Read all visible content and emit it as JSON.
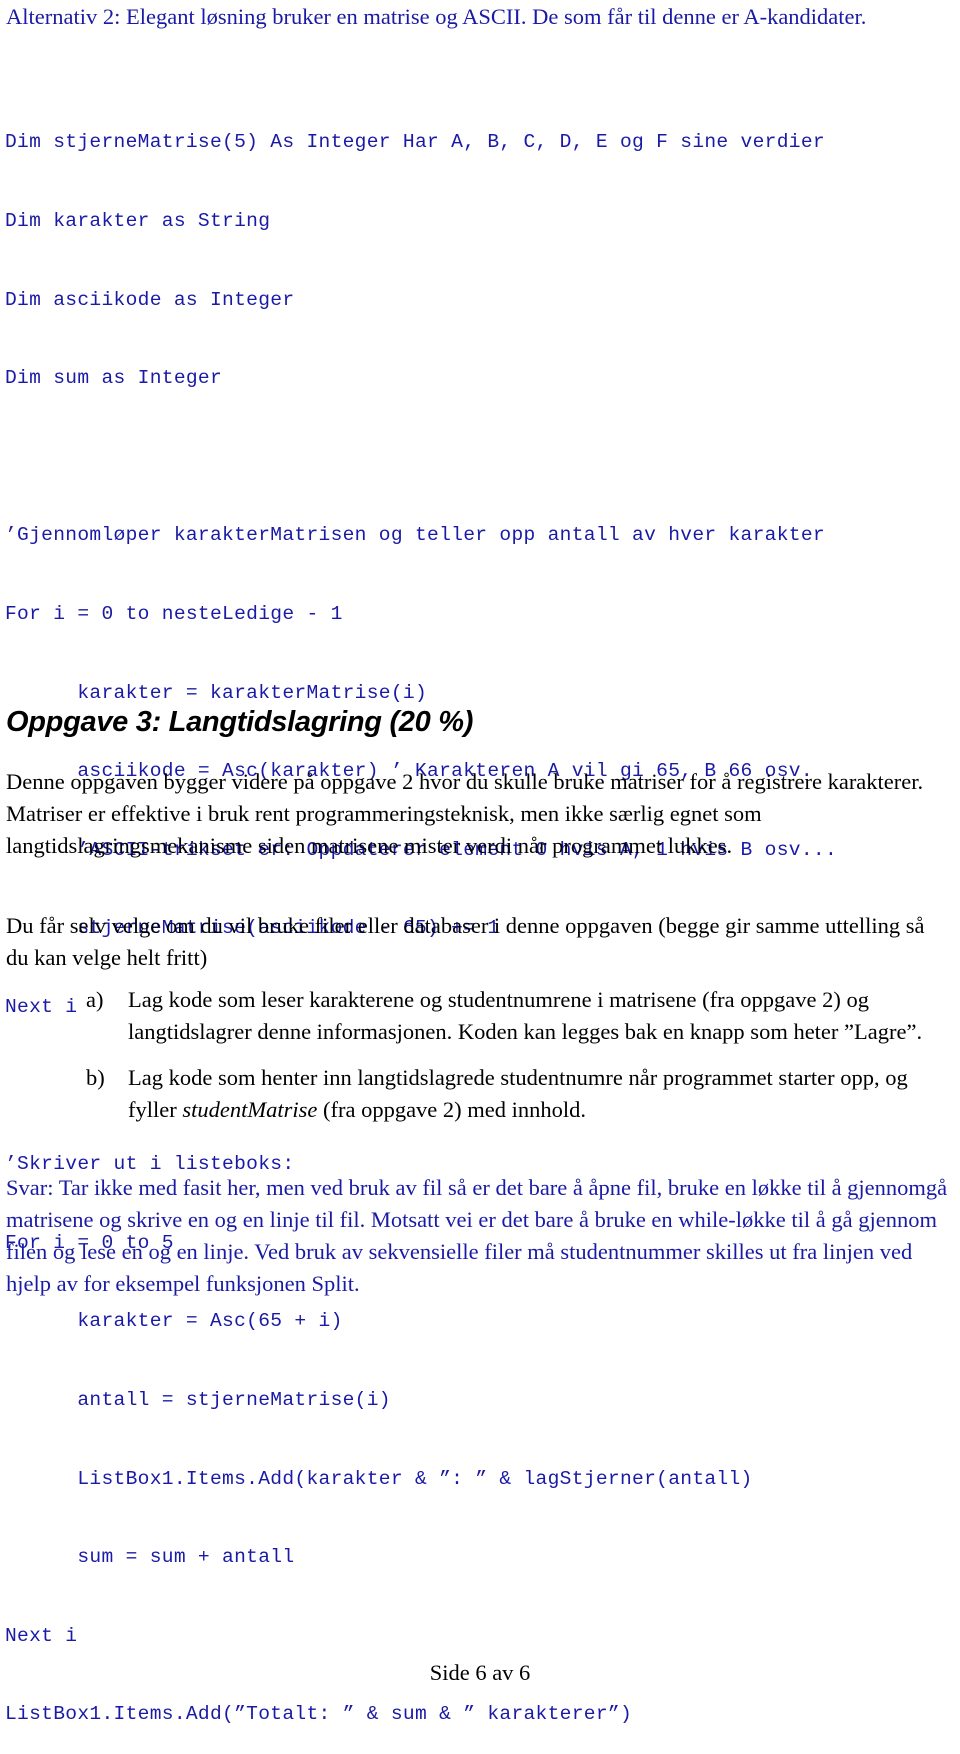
{
  "intro": "Alternativ 2: Elegant løsning bruker en matrise og ASCII. De som får til denne er A-kandidater.",
  "code_lines": [
    "Dim stjerneMatrise(5) As Integer Har A, B, C, D, E og F sine verdier",
    "Dim karakter as String",
    "Dim asciikode as Integer",
    "Dim sum as Integer",
    "",
    "’Gjennomløper karakterMatrisen og teller opp antall av hver karakter",
    "For i = 0 to nesteLedige - 1",
    "      karakter = karakterMatrise(i)",
    "      asciikode = Asc(karakter) ’ Karakteren A vil gi 65, B 66 osv.",
    "      ’ASCII-trikset er: Oppdaterer element 0 hvis A, 1 hvis B osv...",
    "      stjerneMatrise(asciikode - 65) += 1",
    "Next i",
    "",
    "’Skriver ut i listeboks:",
    "For i = 0 to 5",
    "      karakter = Asc(65 + i)",
    "      antall = stjerneMatrise(i)",
    "      ListBox1.Items.Add(karakter & ”: ” & lagStjerner(antall)",
    "      sum = sum + antall",
    "Next i",
    "ListBox1.Items.Add(”Totalt: ” & sum & ” karakterer”)"
  ],
  "section": {
    "heading": "Oppgave 3: Langtidslagring (20 %)",
    "paragraph1": "Denne oppgaven bygger videre på oppgave 2 hvor du skulle bruke matriser for å registrere karakterer. Matriser er effektive i bruk rent programmeringsteknisk, men ikke særlig egnet som langtidslagringsmekanisme siden matrisene mister verdi når programmet lukkes.",
    "paragraph2": "Du får selv velge om du vil bruke filer eller databaser i denne oppgaven (begge gir samme uttelling så du kan velge helt fritt)",
    "items": [
      {
        "marker": "a)",
        "text": "Lag kode som leser karakterene og studentnumrene i matrisene (fra oppgave 2) og langtidslagrer denne informasjonen. Koden kan legges bak en knapp som heter ”Lagre”."
      },
      {
        "marker": "b)",
        "text_before": "Lag kode som henter inn langtidslagrede studentnumre når programmet starter opp, og fyller ",
        "text_italic": "studentMatrise",
        "text_after": " (fra oppgave 2) med innhold."
      }
    ],
    "answer": "Svar: Tar ikke med fasit her, men ved bruk av fil så er det bare å åpne fil, bruke en løkke til å gjennomgå matrisene og skrive en og en linje til fil. Motsatt vei er det bare å bruke en while-løkke til å gå gjennom filen og lese en og en linje. Ved bruk av sekvensielle filer må studentnummer skilles ut fra linjen ved hjelp av for eksempel funksjonen Split."
  },
  "footer": "Side 6 av 6",
  "colors": {
    "answer_text": "#1a1aa6",
    "body_text": "#000000"
  }
}
